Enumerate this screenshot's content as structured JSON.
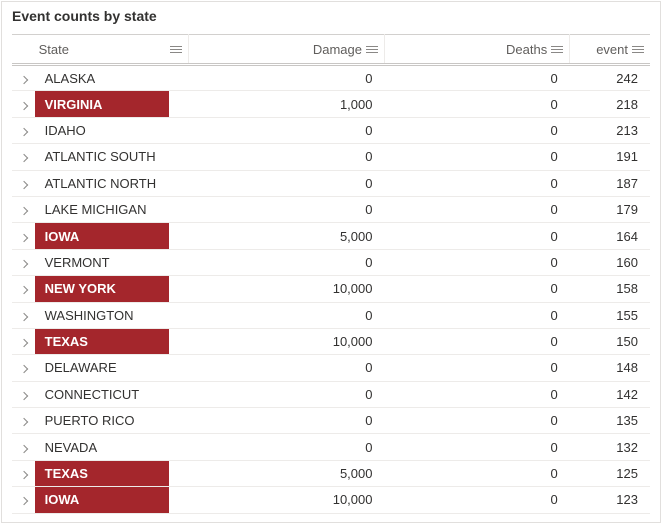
{
  "title": "Event counts by state",
  "columns": {
    "state": "State",
    "damage": "Damage",
    "deaths": "Deaths",
    "event": "event"
  },
  "rows": [
    {
      "state": "ALASKA",
      "damage": "0",
      "deaths": "0",
      "event": "242",
      "highlight": false
    },
    {
      "state": "VIRGINIA",
      "damage": "1,000",
      "deaths": "0",
      "event": "218",
      "highlight": true
    },
    {
      "state": "IDAHO",
      "damage": "0",
      "deaths": "0",
      "event": "213",
      "highlight": false
    },
    {
      "state": "ATLANTIC SOUTH",
      "damage": "0",
      "deaths": "0",
      "event": "191",
      "highlight": false
    },
    {
      "state": "ATLANTIC NORTH",
      "damage": "0",
      "deaths": "0",
      "event": "187",
      "highlight": false
    },
    {
      "state": "LAKE MICHIGAN",
      "damage": "0",
      "deaths": "0",
      "event": "179",
      "highlight": false
    },
    {
      "state": "IOWA",
      "damage": "5,000",
      "deaths": "0",
      "event": "164",
      "highlight": true
    },
    {
      "state": "VERMONT",
      "damage": "0",
      "deaths": "0",
      "event": "160",
      "highlight": false
    },
    {
      "state": "NEW YORK",
      "damage": "10,000",
      "deaths": "0",
      "event": "158",
      "highlight": true
    },
    {
      "state": "WASHINGTON",
      "damage": "0",
      "deaths": "0",
      "event": "155",
      "highlight": false
    },
    {
      "state": "TEXAS",
      "damage": "10,000",
      "deaths": "0",
      "event": "150",
      "highlight": true
    },
    {
      "state": "DELAWARE",
      "damage": "0",
      "deaths": "0",
      "event": "148",
      "highlight": false
    },
    {
      "state": "CONNECTICUT",
      "damage": "0",
      "deaths": "0",
      "event": "142",
      "highlight": false
    },
    {
      "state": "PUERTO RICO",
      "damage": "0",
      "deaths": "0",
      "event": "135",
      "highlight": false
    },
    {
      "state": "NEVADA",
      "damage": "0",
      "deaths": "0",
      "event": "132",
      "highlight": false
    },
    {
      "state": "TEXAS",
      "damage": "5,000",
      "deaths": "0",
      "event": "125",
      "highlight": true
    },
    {
      "state": "IOWA",
      "damage": "10,000",
      "deaths": "0",
      "event": "123",
      "highlight": true
    }
  ]
}
